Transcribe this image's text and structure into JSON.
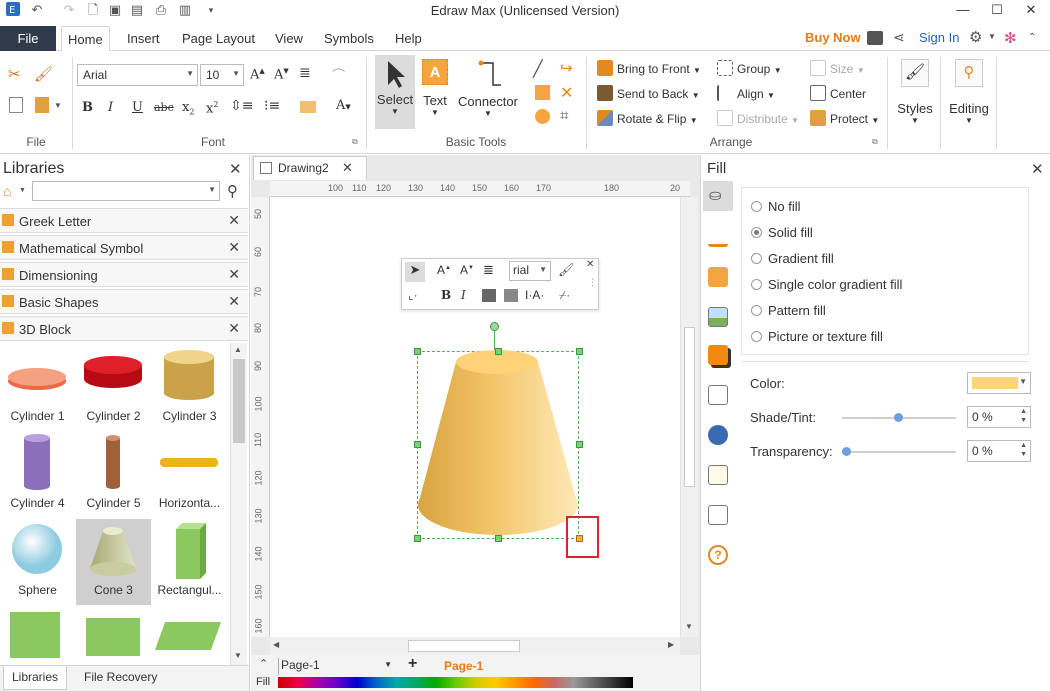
{
  "window": {
    "title": "Edraw Max (Unlicensed Version)"
  },
  "menu": {
    "file": "File",
    "tabs": [
      "Home",
      "Insert",
      "Page Layout",
      "View",
      "Symbols",
      "Help"
    ],
    "buy_now": "Buy Now",
    "sign_in": "Sign In"
  },
  "ribbon": {
    "font_name": "Arial",
    "font_size": "10",
    "groups": {
      "file": "File",
      "font": "Font",
      "basic_tools": "Basic Tools",
      "arrange": "Arrange"
    },
    "tools": {
      "select": "Select",
      "text": "Text",
      "connector": "Connector"
    },
    "arrange": {
      "bring_to_front": "Bring to Front",
      "send_to_back": "Send to Back",
      "rotate_flip": "Rotate & Flip",
      "group": "Group",
      "align": "Align",
      "distribute": "Distribute",
      "size": "Size",
      "center": "Center",
      "protect": "Protect"
    },
    "styles": "Styles",
    "editing": "Editing"
  },
  "libraries": {
    "title": "Libraries",
    "categories": [
      "Greek Letter",
      "Mathematical Symbol",
      "Dimensioning",
      "Basic Shapes",
      "3D Block"
    ],
    "shapes": [
      "Cylinder 1",
      "Cylinder 2",
      "Cylinder 3",
      "Cylinder 4",
      "Cylinder 5",
      "Horizonta...",
      "Sphere",
      "Cone 3",
      "Rectangul..."
    ],
    "selected_shape": "Cone 3",
    "bottom_tabs": [
      "Libraries",
      "File Recovery"
    ]
  },
  "canvas": {
    "doc_tab": "Drawing2",
    "ruler_h": [
      "100",
      "110",
      "120",
      "130",
      "140",
      "150",
      "160",
      "170",
      "180",
      "20"
    ],
    "ruler_v": [
      "50",
      "60",
      "70",
      "80",
      "90",
      "100",
      "110",
      "120",
      "130",
      "140",
      "150",
      "160"
    ],
    "mini_font": "rial",
    "page_selector": "Page-1",
    "page_tab": "Page-1",
    "fill_label": "Fill"
  },
  "fill_panel": {
    "title": "Fill",
    "options": [
      "No fill",
      "Solid fill",
      "Gradient fill",
      "Single color gradient fill",
      "Pattern fill",
      "Picture or texture fill"
    ],
    "selected": "Solid fill",
    "color_label": "Color:",
    "color_value": "#ffd47a",
    "shade_label": "Shade/Tint:",
    "shade_value": "0 %",
    "transparency_label": "Transparency:",
    "transparency_value": "0 %"
  },
  "colors": {
    "accent_orange": "#e47b16",
    "file_tab": "#2f3a4a",
    "link_blue": "#2a63b2",
    "cone_fill": "#f2c468"
  }
}
